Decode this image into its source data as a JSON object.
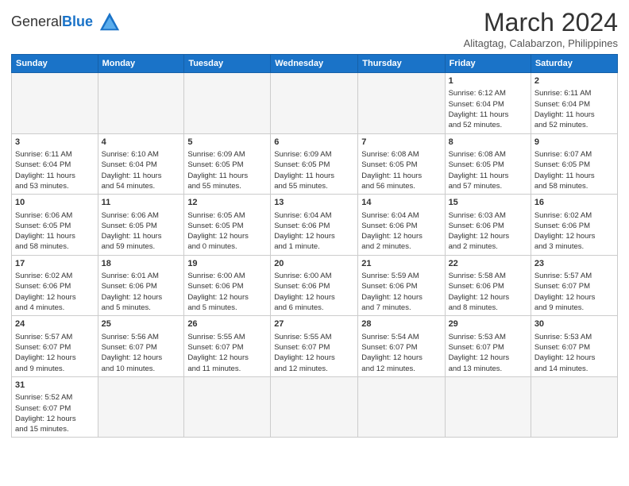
{
  "header": {
    "logo_general": "General",
    "logo_blue": "Blue",
    "month_year": "March 2024",
    "location": "Alitagtag, Calabarzon, Philippines"
  },
  "weekdays": [
    "Sunday",
    "Monday",
    "Tuesday",
    "Wednesday",
    "Thursday",
    "Friday",
    "Saturday"
  ],
  "weeks": [
    [
      {
        "day": "",
        "info": ""
      },
      {
        "day": "",
        "info": ""
      },
      {
        "day": "",
        "info": ""
      },
      {
        "day": "",
        "info": ""
      },
      {
        "day": "",
        "info": ""
      },
      {
        "day": "1",
        "info": "Sunrise: 6:12 AM\nSunset: 6:04 PM\nDaylight: 11 hours\nand 52 minutes."
      },
      {
        "day": "2",
        "info": "Sunrise: 6:11 AM\nSunset: 6:04 PM\nDaylight: 11 hours\nand 52 minutes."
      }
    ],
    [
      {
        "day": "3",
        "info": "Sunrise: 6:11 AM\nSunset: 6:04 PM\nDaylight: 11 hours\nand 53 minutes."
      },
      {
        "day": "4",
        "info": "Sunrise: 6:10 AM\nSunset: 6:04 PM\nDaylight: 11 hours\nand 54 minutes."
      },
      {
        "day": "5",
        "info": "Sunrise: 6:09 AM\nSunset: 6:05 PM\nDaylight: 11 hours\nand 55 minutes."
      },
      {
        "day": "6",
        "info": "Sunrise: 6:09 AM\nSunset: 6:05 PM\nDaylight: 11 hours\nand 55 minutes."
      },
      {
        "day": "7",
        "info": "Sunrise: 6:08 AM\nSunset: 6:05 PM\nDaylight: 11 hours\nand 56 minutes."
      },
      {
        "day": "8",
        "info": "Sunrise: 6:08 AM\nSunset: 6:05 PM\nDaylight: 11 hours\nand 57 minutes."
      },
      {
        "day": "9",
        "info": "Sunrise: 6:07 AM\nSunset: 6:05 PM\nDaylight: 11 hours\nand 58 minutes."
      }
    ],
    [
      {
        "day": "10",
        "info": "Sunrise: 6:06 AM\nSunset: 6:05 PM\nDaylight: 11 hours\nand 58 minutes."
      },
      {
        "day": "11",
        "info": "Sunrise: 6:06 AM\nSunset: 6:05 PM\nDaylight: 11 hours\nand 59 minutes."
      },
      {
        "day": "12",
        "info": "Sunrise: 6:05 AM\nSunset: 6:05 PM\nDaylight: 12 hours\nand 0 minutes."
      },
      {
        "day": "13",
        "info": "Sunrise: 6:04 AM\nSunset: 6:06 PM\nDaylight: 12 hours\nand 1 minute."
      },
      {
        "day": "14",
        "info": "Sunrise: 6:04 AM\nSunset: 6:06 PM\nDaylight: 12 hours\nand 2 minutes."
      },
      {
        "day": "15",
        "info": "Sunrise: 6:03 AM\nSunset: 6:06 PM\nDaylight: 12 hours\nand 2 minutes."
      },
      {
        "day": "16",
        "info": "Sunrise: 6:02 AM\nSunset: 6:06 PM\nDaylight: 12 hours\nand 3 minutes."
      }
    ],
    [
      {
        "day": "17",
        "info": "Sunrise: 6:02 AM\nSunset: 6:06 PM\nDaylight: 12 hours\nand 4 minutes."
      },
      {
        "day": "18",
        "info": "Sunrise: 6:01 AM\nSunset: 6:06 PM\nDaylight: 12 hours\nand 5 minutes."
      },
      {
        "day": "19",
        "info": "Sunrise: 6:00 AM\nSunset: 6:06 PM\nDaylight: 12 hours\nand 5 minutes."
      },
      {
        "day": "20",
        "info": "Sunrise: 6:00 AM\nSunset: 6:06 PM\nDaylight: 12 hours\nand 6 minutes."
      },
      {
        "day": "21",
        "info": "Sunrise: 5:59 AM\nSunset: 6:06 PM\nDaylight: 12 hours\nand 7 minutes."
      },
      {
        "day": "22",
        "info": "Sunrise: 5:58 AM\nSunset: 6:06 PM\nDaylight: 12 hours\nand 8 minutes."
      },
      {
        "day": "23",
        "info": "Sunrise: 5:57 AM\nSunset: 6:07 PM\nDaylight: 12 hours\nand 9 minutes."
      }
    ],
    [
      {
        "day": "24",
        "info": "Sunrise: 5:57 AM\nSunset: 6:07 PM\nDaylight: 12 hours\nand 9 minutes."
      },
      {
        "day": "25",
        "info": "Sunrise: 5:56 AM\nSunset: 6:07 PM\nDaylight: 12 hours\nand 10 minutes."
      },
      {
        "day": "26",
        "info": "Sunrise: 5:55 AM\nSunset: 6:07 PM\nDaylight: 12 hours\nand 11 minutes."
      },
      {
        "day": "27",
        "info": "Sunrise: 5:55 AM\nSunset: 6:07 PM\nDaylight: 12 hours\nand 12 minutes."
      },
      {
        "day": "28",
        "info": "Sunrise: 5:54 AM\nSunset: 6:07 PM\nDaylight: 12 hours\nand 12 minutes."
      },
      {
        "day": "29",
        "info": "Sunrise: 5:53 AM\nSunset: 6:07 PM\nDaylight: 12 hours\nand 13 minutes."
      },
      {
        "day": "30",
        "info": "Sunrise: 5:53 AM\nSunset: 6:07 PM\nDaylight: 12 hours\nand 14 minutes."
      }
    ],
    [
      {
        "day": "31",
        "info": "Sunrise: 5:52 AM\nSunset: 6:07 PM\nDaylight: 12 hours\nand 15 minutes."
      },
      {
        "day": "",
        "info": ""
      },
      {
        "day": "",
        "info": ""
      },
      {
        "day": "",
        "info": ""
      },
      {
        "day": "",
        "info": ""
      },
      {
        "day": "",
        "info": ""
      },
      {
        "day": "",
        "info": ""
      }
    ]
  ]
}
